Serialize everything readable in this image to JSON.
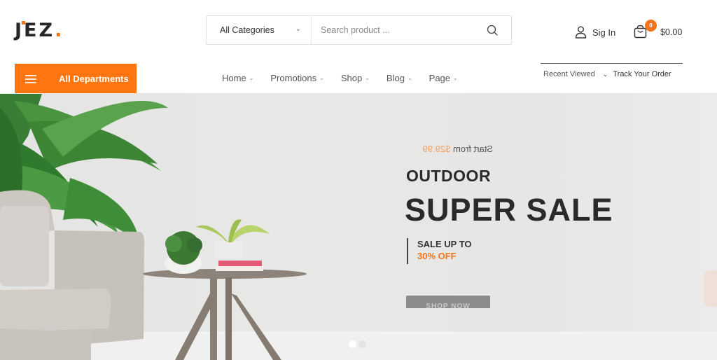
{
  "brand": {
    "name": "JEZ",
    "accent": "#f37318"
  },
  "search": {
    "category_selected": "All Categories",
    "placeholder": "Search product ...",
    "value": ""
  },
  "account": {
    "signin_label": "Sig In"
  },
  "cart": {
    "count": "0",
    "total": "$0.00"
  },
  "nav": {
    "departments_label": "All Departments",
    "menu": [
      {
        "label": "Home"
      },
      {
        "label": "Promotions"
      },
      {
        "label": "Shop"
      },
      {
        "label": "Blog"
      },
      {
        "label": "Page"
      }
    ],
    "recent_viewed": "Recent Viewed",
    "track_order": "Track Your Order"
  },
  "hero": {
    "start_from_label": "Start from",
    "start_from_price": "$29.99",
    "kicker": "OUTDOOR",
    "title": "SUPER SALE",
    "sale_line1": "SALE UP TO",
    "sale_line2": "30% OFF",
    "cta": "SHOP NOW",
    "slides_total": 2,
    "active_slide": 1
  }
}
